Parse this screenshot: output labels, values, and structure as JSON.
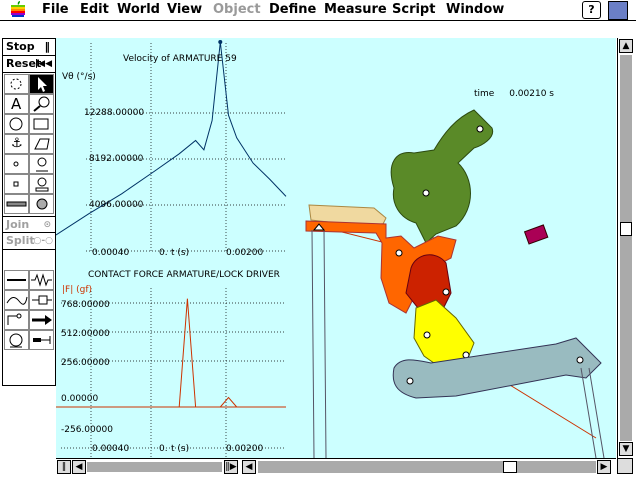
{
  "menubar": {
    "items": [
      "File",
      "Edit",
      "World",
      "View",
      "Object",
      "Define",
      "Measure",
      "Script",
      "Window"
    ],
    "disabled": [
      "Object"
    ],
    "help_label": "?"
  },
  "toolbar": {
    "stop_label": "Stop",
    "reset_label": "Reset",
    "join_label": "Join",
    "split_label": "Split"
  },
  "time_readout": {
    "label": "time",
    "value": "0.00210 s"
  },
  "graph_velocity": {
    "title": "Velocity of ARMATURE 59",
    "ylabel": "Vθ (°/s)",
    "xlabel": "t (s)",
    "yticks": [
      "12288.00000",
      "8192.00000",
      "4096.00000"
    ],
    "xticks": [
      "0.00040",
      "0.",
      "0.00200"
    ]
  },
  "graph_force": {
    "title": "CONTACT FORCE ARMATURE/LOCK DRIVER",
    "ylabel": "|F| (gf)",
    "xlabel": "t (s)",
    "yticks": [
      "768.00000",
      "512.00000",
      "256.00000",
      "0.00000",
      "-256.00000"
    ],
    "xticks": [
      "0.00040",
      "0.",
      "0.00200"
    ]
  },
  "chart_data": [
    {
      "type": "line",
      "title": "Velocity of ARMATURE 59",
      "ylabel": "Vθ (°/s)",
      "xlabel": "t (s)",
      "x": [
        0.0,
        0.0004,
        0.0008,
        0.0012,
        0.0015,
        0.0017,
        0.0018,
        0.0019,
        0.002,
        0.0021,
        0.0022,
        0.0024,
        0.0026,
        0.0028
      ],
      "series": [
        {
          "values": [
            1200,
            2800,
            4300,
            6000,
            7300,
            8300,
            7600,
            9800,
            15700,
            10200,
            8500,
            6600,
            5400,
            4100
          ]
        }
      ],
      "ylim": [
        0,
        16000
      ],
      "grid": true
    },
    {
      "type": "line",
      "title": "CONTACT FORCE ARMATURE/LOCK DRIVER",
      "ylabel": "|F| (gf)",
      "xlabel": "t (s)",
      "x": [
        0.0,
        0.0014,
        0.0015,
        0.0016,
        0.0017,
        0.0018,
        0.0019,
        0.002,
        0.0021,
        0.0022,
        0.0024
      ],
      "series": [
        {
          "values": [
            0,
            0,
            0,
            800,
            0,
            0,
            0,
            0,
            70,
            0,
            0
          ]
        }
      ],
      "ylim": [
        -320,
        820
      ],
      "grid": true
    }
  ],
  "colors": {
    "canvas_bg": "#ccffff",
    "green_part": "#5a8a28",
    "orange_part": "#ff6600",
    "red_part": "#cc2200",
    "yellow_part": "#ffff00",
    "slate_part": "#99bbc0",
    "magenta_part": "#aa0055",
    "trace_line": "#cc3300"
  },
  "scroll": {
    "vertical_position": 0.45,
    "horizontal_position": 0.75
  }
}
